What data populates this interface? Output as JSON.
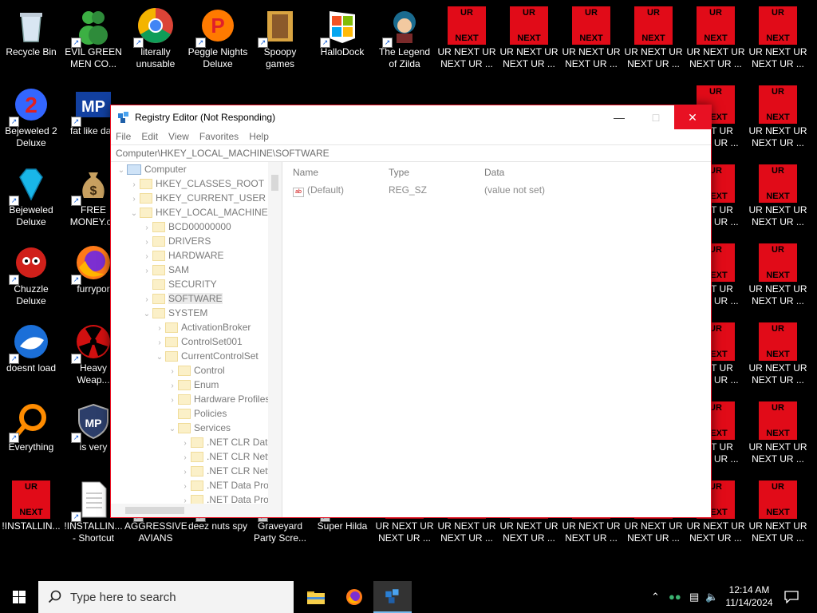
{
  "desktop": {
    "icons": [
      {
        "label": "Recycle Bin",
        "kind": "recycle-bin-icon"
      },
      {
        "label": "EVIL GREEN\nMEN CO...",
        "kind": "green-men-icon"
      },
      {
        "label": "literally\nunusable",
        "kind": "chrome-icon"
      },
      {
        "label": "Peggle Nights\nDeluxe",
        "kind": "peggle-icon"
      },
      {
        "label": "Spoopy\ngames",
        "kind": "folder-icon"
      },
      {
        "label": "HalloDock",
        "kind": "windows-logo-icon"
      },
      {
        "label": "The Legend\nof Zilda",
        "kind": "character-icon"
      },
      {
        "label": "Bejeweled 2\nDeluxe",
        "kind": "bejeweled-icon"
      },
      {
        "label": "fat like darl",
        "kind": "mp-logo-icon"
      },
      {
        "label": "Bejeweled\nDeluxe",
        "kind": "diamond-icon"
      },
      {
        "label": "FREE\nMONEY.co",
        "kind": "money-bag-icon"
      },
      {
        "label": "Chuzzle\nDeluxe",
        "kind": "chuzzle-icon"
      },
      {
        "label": "furrypor",
        "kind": "firefox-icon"
      },
      {
        "label": "doesnt load",
        "kind": "thunderbird-icon"
      },
      {
        "label": "Heavy\nWeap...",
        "kind": "radiation-icon"
      },
      {
        "label": "Everything",
        "kind": "everything-search-icon"
      },
      {
        "label": "is very",
        "kind": "shield-icon"
      },
      {
        "label": "!INSTALLIN...",
        "kind": "ur-next-icon"
      },
      {
        "label": "!INSTALLIN...\n- Shortcut",
        "kind": "document-icon"
      },
      {
        "label": "AGGRESSIVE\nAVIANS",
        "kind": "blank-icon"
      },
      {
        "label": "deez nuts spy",
        "kind": "blank-icon"
      },
      {
        "label": "Graveyard\nParty Scre...",
        "kind": "blank-icon"
      },
      {
        "label": "Super Hilda",
        "kind": "blank-icon"
      }
    ],
    "ur_tile": {
      "top": "UR",
      "bottom": "NEXT",
      "label": "UR NEXT UR\nNEXT UR ..."
    },
    "ur_tile_right_label": "EXT UR\nEXT UR ..."
  },
  "window": {
    "title": "Registry Editor (Not Responding)",
    "menu": [
      "File",
      "Edit",
      "View",
      "Favorites",
      "Help"
    ],
    "address": "Computer\\HKEY_LOCAL_MACHINE\\SOFTWARE",
    "tree": [
      {
        "label": "Computer",
        "level": 0,
        "chev": "v",
        "type": "pc"
      },
      {
        "label": "HKEY_CLASSES_ROOT",
        "level": 1,
        "chev": ">"
      },
      {
        "label": "HKEY_CURRENT_USER",
        "level": 1,
        "chev": ">"
      },
      {
        "label": "HKEY_LOCAL_MACHINE",
        "level": 1,
        "chev": "v"
      },
      {
        "label": "BCD00000000",
        "level": 2,
        "chev": ">"
      },
      {
        "label": "DRIVERS",
        "level": 2,
        "chev": ">"
      },
      {
        "label": "HARDWARE",
        "level": 2,
        "chev": ">"
      },
      {
        "label": "SAM",
        "level": 2,
        "chev": ">"
      },
      {
        "label": "SECURITY",
        "level": 2,
        "chev": ""
      },
      {
        "label": "SOFTWARE",
        "level": 2,
        "chev": ">",
        "selected": true
      },
      {
        "label": "SYSTEM",
        "level": 2,
        "chev": "v"
      },
      {
        "label": "ActivationBroker",
        "level": 3,
        "chev": ">"
      },
      {
        "label": "ControlSet001",
        "level": 3,
        "chev": ">"
      },
      {
        "label": "CurrentControlSet",
        "level": 3,
        "chev": "v"
      },
      {
        "label": "Control",
        "level": 4,
        "chev": ">"
      },
      {
        "label": "Enum",
        "level": 4,
        "chev": ">"
      },
      {
        "label": "Hardware Profiles",
        "level": 4,
        "chev": ">"
      },
      {
        "label": "Policies",
        "level": 4,
        "chev": ""
      },
      {
        "label": "Services",
        "level": 4,
        "chev": "v"
      },
      {
        "label": ".NET CLR Data",
        "level": 5,
        "chev": ">"
      },
      {
        "label": ".NET CLR Netw",
        "level": 5,
        "chev": ">"
      },
      {
        "label": ".NET CLR Netw",
        "level": 5,
        "chev": ">"
      },
      {
        "label": ".NET Data Prov",
        "level": 5,
        "chev": ">"
      },
      {
        "label": ".NET Data Prov",
        "level": 5,
        "chev": ">"
      }
    ],
    "columns": {
      "name": "Name",
      "type": "Type",
      "data": "Data"
    },
    "value_row": {
      "name": "(Default)",
      "type": "REG_SZ",
      "data": "(value not set)"
    }
  },
  "taskbar": {
    "search_placeholder": "Type here to search",
    "time": "12:14 AM",
    "date": "11/14/2024"
  },
  "colors": {
    "ur_red": "#e10b18",
    "close_red": "#e81123",
    "taskbar_black": "#000000"
  }
}
